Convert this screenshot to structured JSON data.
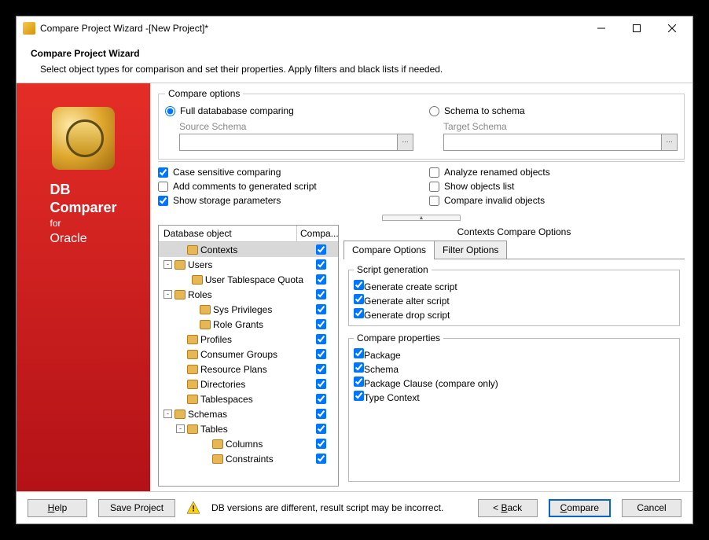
{
  "window": {
    "title": "Compare Project Wizard -[New Project]*"
  },
  "header": {
    "title": "Compare Project Wizard",
    "subtitle": "Select object types for comparison and set their properties. Apply filters and black lists if needed."
  },
  "sidebar": {
    "product_line1": "DB",
    "product_line2": "Comparer",
    "for": "for",
    "db": "Oracle"
  },
  "compare_options": {
    "legend": "Compare options",
    "radio_full": "Full datababase comparing",
    "radio_schema": "Schema to schema",
    "source_label": "Source Schema",
    "target_label": "Target Schema",
    "source_value": "",
    "target_value": "",
    "left_checks": {
      "case_sensitive": "Case sensitive comparing",
      "add_comments": "Add comments to generated script",
      "show_storage": "Show storage parameters"
    },
    "right_checks": {
      "analyze_renamed": "Analyze renamed objects",
      "show_objects": "Show objects list",
      "compare_invalid": "Compare invalid objects"
    }
  },
  "tree": {
    "header_obj": "Database object",
    "header_comp": "Compa...",
    "rows": [
      {
        "indent": 1,
        "expander": "",
        "label": "Contexts",
        "checked": true,
        "selected": true
      },
      {
        "indent": 0,
        "expander": "-",
        "label": "Users",
        "checked": true
      },
      {
        "indent": 2,
        "expander": "",
        "label": "User Tablespace Quota",
        "checked": true
      },
      {
        "indent": 0,
        "expander": "-",
        "label": "Roles",
        "checked": true
      },
      {
        "indent": 2,
        "expander": "",
        "label": "Sys Privileges",
        "checked": true
      },
      {
        "indent": 2,
        "expander": "",
        "label": "Role Grants",
        "checked": true
      },
      {
        "indent": 1,
        "expander": "",
        "label": "Profiles",
        "checked": true
      },
      {
        "indent": 1,
        "expander": "",
        "label": "Consumer Groups",
        "checked": true
      },
      {
        "indent": 1,
        "expander": "",
        "label": "Resource Plans",
        "checked": true
      },
      {
        "indent": 1,
        "expander": "",
        "label": "Directories",
        "checked": true
      },
      {
        "indent": 1,
        "expander": "",
        "label": "Tablespaces",
        "checked": true
      },
      {
        "indent": 0,
        "expander": "-",
        "label": "Schemas",
        "checked": true
      },
      {
        "indent": 1,
        "expander": "-",
        "label": "Tables",
        "checked": true
      },
      {
        "indent": 3,
        "expander": "",
        "label": "Columns",
        "checked": true
      },
      {
        "indent": 3,
        "expander": "",
        "label": "Constraints",
        "checked": true
      }
    ]
  },
  "options_panel": {
    "title": "Contexts Compare Options",
    "tab_compare": "Compare Options",
    "tab_filter": "Filter Options",
    "script_gen_legend": "Script generation",
    "script_gen": {
      "create": "Generate create script",
      "alter": "Generate alter script",
      "drop": "Generate drop script"
    },
    "compare_props_legend": "Compare properties",
    "compare_props": {
      "package": "Package",
      "schema": "Schema",
      "pkg_clause": "Package Clause (compare only)",
      "type_ctx": "Type Context"
    }
  },
  "bottombar": {
    "help": "Help",
    "save": "Save Project",
    "status": "DB versions are different, result script may be incorrect.",
    "back": "< Back",
    "compare": "Compare",
    "cancel": "Cancel"
  }
}
